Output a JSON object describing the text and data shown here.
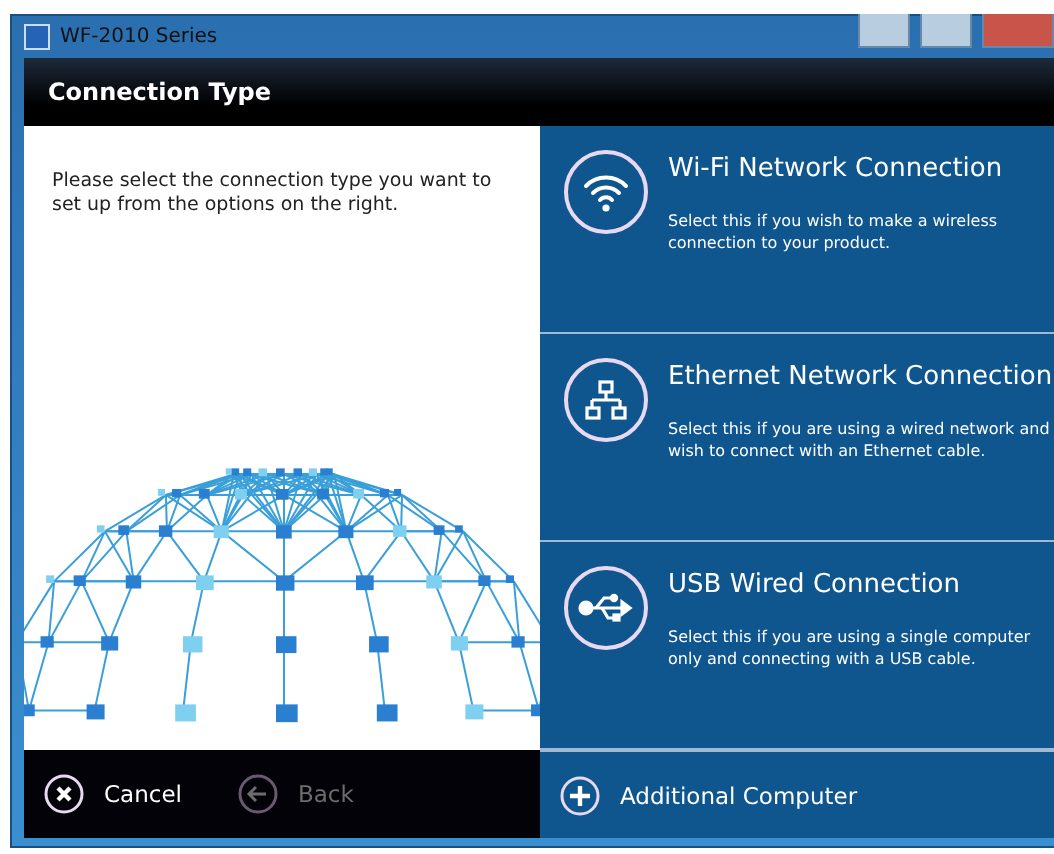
{
  "window": {
    "title": "WF-2010 Series"
  },
  "header": {
    "title": "Connection Type"
  },
  "instructions": "Please select the connection type you want to set up from the options on the right.",
  "options": [
    {
      "kind": "wifi",
      "title": "Wi-Fi Network Connection",
      "description": "Select this if you wish to make a wireless connection to your product."
    },
    {
      "kind": "ethernet",
      "title": "Ethernet Network Connection",
      "description": "Select this if you are using a wired network and wish to connect with an Ethernet cable."
    },
    {
      "kind": "usb",
      "title": "USB Wired Connection",
      "description": "Select this if you are using a single computer only and connecting with a USB cable."
    }
  ],
  "footer": {
    "buttons": [
      {
        "kind": "cancel",
        "label": "Cancel",
        "disabled": false
      },
      {
        "kind": "back",
        "label": "Back",
        "disabled": true
      }
    ],
    "additional": {
      "label": "Additional Computer"
    }
  }
}
